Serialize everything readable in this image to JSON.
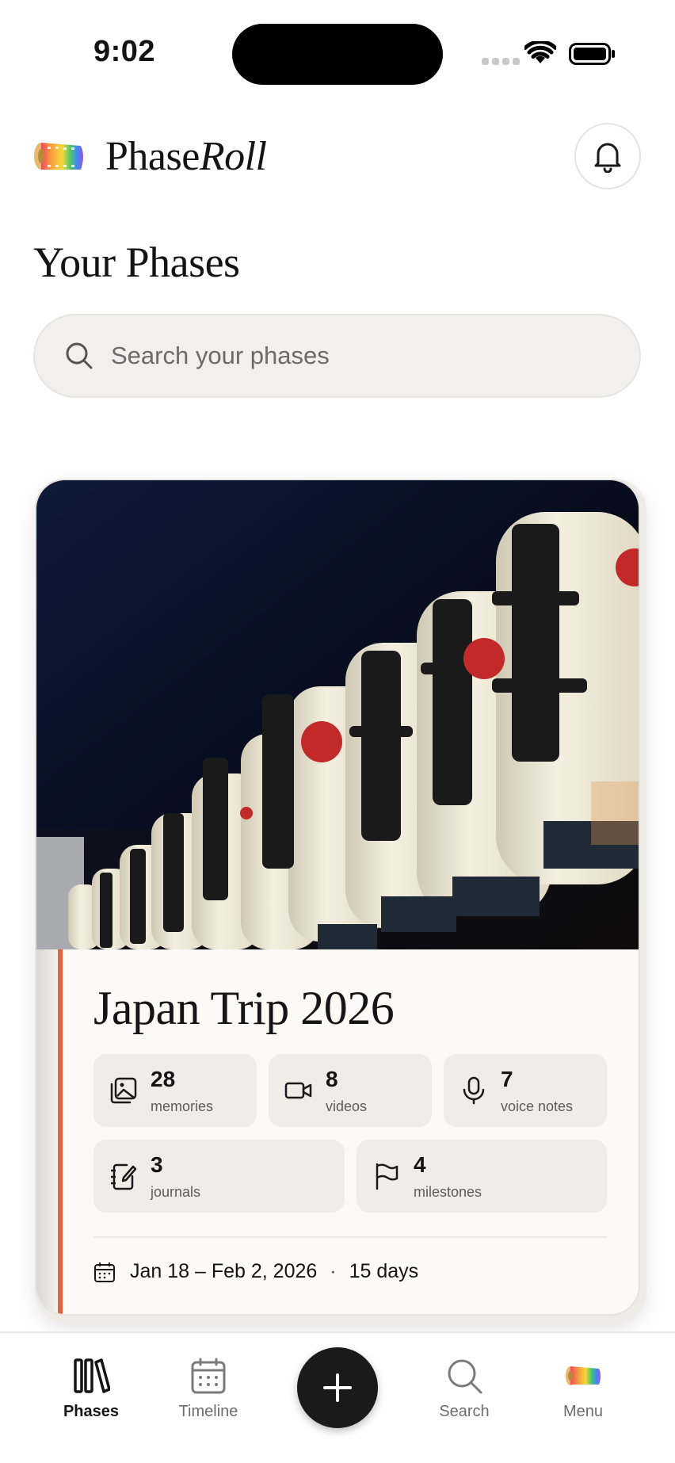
{
  "status_bar": {
    "time": "9:02"
  },
  "header": {
    "brand_prefix": "Phase",
    "brand_suffix": "Roll",
    "logo_icon": "film-roll-rainbow-icon",
    "notification_icon": "bell-icon"
  },
  "page": {
    "title": "Your Phases"
  },
  "search": {
    "placeholder": "Search your phases",
    "value": ""
  },
  "phase_card": {
    "title": "Japan Trip 2026",
    "accent_color": "#e2643f",
    "stats": [
      {
        "count": "28",
        "label": "memories",
        "icon": "photos-icon"
      },
      {
        "count": "8",
        "label": "videos",
        "icon": "video-camera-icon"
      },
      {
        "count": "7",
        "label": "voice notes",
        "icon": "microphone-icon"
      },
      {
        "count": "3",
        "label": "journals",
        "icon": "journal-icon"
      },
      {
        "count": "4",
        "label": "milestones",
        "icon": "flag-icon"
      }
    ],
    "date_range": "Jan 18 – Feb 2, 2026",
    "separator": "·",
    "duration": "15 days"
  },
  "tab_bar": {
    "tabs": [
      {
        "label": "Phases",
        "icon": "phases-books-icon",
        "active": true
      },
      {
        "label": "Timeline",
        "icon": "calendar-icon",
        "active": false
      },
      {
        "label": "Search",
        "icon": "search-icon",
        "active": false
      },
      {
        "label": "Menu",
        "icon": "film-roll-rainbow-icon",
        "active": false
      }
    ],
    "add_button_icon": "plus-icon"
  }
}
